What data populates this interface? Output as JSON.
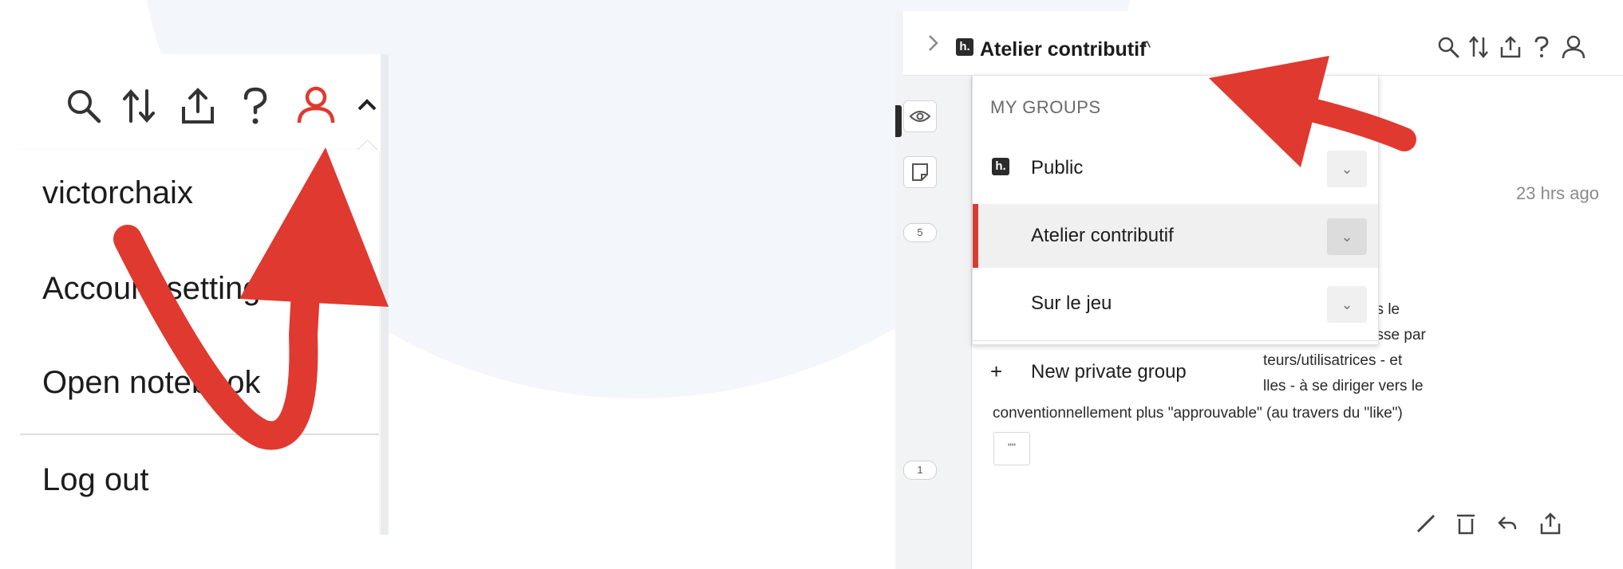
{
  "left_panel": {
    "user_menu": {
      "username": "victorchaix",
      "account_settings": "Account settings",
      "open_notebook": "Open notebook",
      "log_out": "Log out"
    },
    "toolbar_icons": [
      "search-icon",
      "sort-icon",
      "share-icon",
      "help-icon",
      "user-icon",
      "chevron-up-icon"
    ],
    "accent_color": "#e0392f"
  },
  "right_panel": {
    "group_selector": {
      "current_group": "Atelier contributif",
      "caret": "^"
    },
    "dropdown": {
      "header": "MY GROUPS",
      "groups": [
        {
          "label": "Public"
        },
        {
          "label": "Atelier contributif"
        },
        {
          "label": "Sur le jeu"
        }
      ],
      "new_group_plus": "+",
      "new_group_label": "New private group"
    },
    "sidebar": {
      "badge_top": "5",
      "badge_bottom": "1"
    },
    "annotation": {
      "timestamp": "23 hrs ago",
      "lines": [
        "nt davantage vers le",
        "stagram, qui pousse par",
        "teurs/utilisatrices - et",
        "lles - à se diriger vers le",
        "conventionnellement plus \"approuvable\" (au travers du \"like\")"
      ],
      "quote_button": "\"\""
    },
    "colors": {
      "active_bar": "#d93a34",
      "arrow": "#e0392f"
    }
  }
}
